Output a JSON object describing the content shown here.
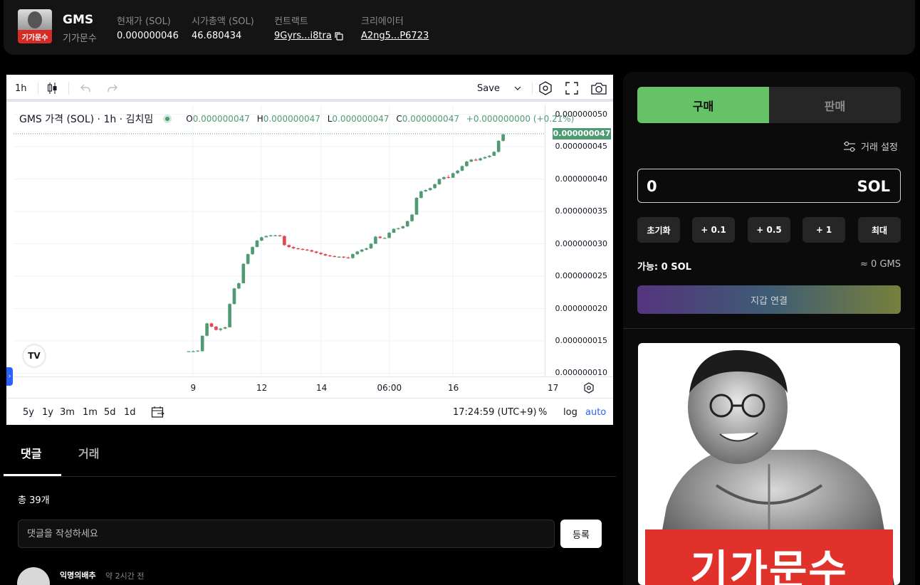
{
  "header": {
    "symbol": "GMS",
    "name": "기가문수",
    "logo_text": "기가문수",
    "price_label": "현재가 (SOL)",
    "price_value": "0.000000046",
    "mcap_label": "시가총액 (SOL)",
    "mcap_value": "46.680434",
    "contract_label": "컨트랙트",
    "contract_value": "9Gyrs...i8tra",
    "creator_label": "크리에이터",
    "creator_value": "A2ng5...P6723"
  },
  "chart_toolbar": {
    "interval": "1h",
    "save_label": "Save"
  },
  "chart_legend": {
    "title": "GMS 가격 (SOL) · 1h · 김치밈",
    "o_label": "O",
    "o_value": "0.000000047",
    "h_label": "H",
    "h_value": "0.000000047",
    "l_label": "L",
    "l_value": "0.000000047",
    "c_label": "C",
    "c_value": "0.000000047",
    "change": "+0.000000000 (+0.21%)"
  },
  "chart_bottom": {
    "ranges": [
      "5y",
      "1y",
      "3m",
      "1m",
      "5d",
      "1d"
    ],
    "clock": "17:24:59 (UTC+9)",
    "percent": "%",
    "log": "log",
    "auto": "auto"
  },
  "chart_data": {
    "type": "candlestick",
    "y_ticks": [
      "0.000000050",
      "0.000000045",
      "0.000000040",
      "0.000000035",
      "0.000000030",
      "0.000000025",
      "0.000000020",
      "0.000000015",
      "0.000000010"
    ],
    "x_ticks": [
      "9",
      "12",
      "14",
      "06:00",
      "16",
      "17"
    ],
    "last_price_label": "0.000000047",
    "ylim": [
      9.5e-09,
      5.15e-08
    ],
    "grid": true,
    "up_color": "#4f9a73",
    "down_color": "#e0474f",
    "candles": [
      [
        1.33e-08,
        1.34e-08,
        1.33e-08,
        1.34e-08
      ],
      [
        1.34e-08,
        1.35e-08,
        1.33e-08,
        1.34e-08
      ],
      [
        1.34e-08,
        1.35e-08,
        1.33e-08,
        1.35e-08
      ],
      [
        1.34e-08,
        1.58e-08,
        1.34e-08,
        1.58e-08
      ],
      [
        1.58e-08,
        1.78e-08,
        1.57e-08,
        1.77e-08
      ],
      [
        1.77e-08,
        1.78e-08,
        1.71e-08,
        1.72e-08
      ],
      [
        1.72e-08,
        1.73e-08,
        1.66e-08,
        1.67e-08
      ],
      [
        1.67e-08,
        1.7e-08,
        1.65e-08,
        1.69e-08
      ],
      [
        1.69e-08,
        1.72e-08,
        1.68e-08,
        1.71e-08
      ],
      [
        1.71e-08,
        2.08e-08,
        1.71e-08,
        2.07e-08
      ],
      [
        2.07e-08,
        2.32e-08,
        2.06e-08,
        2.31e-08
      ],
      [
        2.31e-08,
        2.4e-08,
        2.3e-08,
        2.39e-08
      ],
      [
        2.39e-08,
        2.7e-08,
        2.39e-08,
        2.69e-08
      ],
      [
        2.69e-08,
        2.85e-08,
        2.68e-08,
        2.84e-08
      ],
      [
        2.84e-08,
        2.96e-08,
        2.83e-08,
        2.95e-08
      ],
      [
        2.95e-08,
        3.06e-08,
        2.95e-08,
        3.05e-08
      ],
      [
        3.05e-08,
        3.11e-08,
        3.04e-08,
        3.1e-08
      ],
      [
        3.1e-08,
        3.13e-08,
        3.1e-08,
        3.12e-08
      ],
      [
        3.12e-08,
        3.14e-08,
        3.11e-08,
        3.13e-08
      ],
      [
        3.13e-08,
        3.14e-08,
        3.12e-08,
        3.13e-08
      ],
      [
        3.13e-08,
        3.14e-08,
        3.11e-08,
        3.12e-08
      ],
      [
        3.12e-08,
        3.13e-08,
        2.97e-08,
        2.98e-08
      ],
      [
        2.98e-08,
        2.99e-08,
        2.94e-08,
        2.95e-08
      ],
      [
        2.95e-08,
        2.96e-08,
        2.92e-08,
        2.93e-08
      ],
      [
        2.93e-08,
        2.94e-08,
        2.91e-08,
        2.92e-08
      ],
      [
        2.92e-08,
        2.93e-08,
        2.9e-08,
        2.91e-08
      ],
      [
        2.91e-08,
        2.92e-08,
        2.89e-08,
        2.9e-08
      ],
      [
        2.9e-08,
        2.91e-08,
        2.87e-08,
        2.88e-08
      ],
      [
        2.88e-08,
        2.89e-08,
        2.85e-08,
        2.86e-08
      ],
      [
        2.86e-08,
        2.87e-08,
        2.83e-08,
        2.84e-08
      ],
      [
        2.84e-08,
        2.85e-08,
        2.81e-08,
        2.82e-08
      ],
      [
        2.82e-08,
        2.83e-08,
        2.8e-08,
        2.81e-08
      ],
      [
        2.81e-08,
        2.82e-08,
        2.79e-08,
        2.8e-08
      ],
      [
        2.8e-08,
        2.81e-08,
        2.79e-08,
        2.8e-08
      ],
      [
        2.8e-08,
        2.81e-08,
        2.78e-08,
        2.79e-08
      ],
      [
        2.79e-08,
        2.8e-08,
        2.77e-08,
        2.78e-08
      ],
      [
        2.78e-08,
        2.85e-08,
        2.77e-08,
        2.84e-08
      ],
      [
        2.84e-08,
        2.89e-08,
        2.83e-08,
        2.88e-08
      ],
      [
        2.88e-08,
        2.92e-08,
        2.87e-08,
        2.91e-08
      ],
      [
        2.91e-08,
        2.94e-08,
        2.9e-08,
        2.93e-08
      ],
      [
        2.93e-08,
        3.01e-08,
        2.92e-08,
        3e-08
      ],
      [
        3e-08,
        3.12e-08,
        3e-08,
        3.11e-08
      ],
      [
        3.11e-08,
        3.12e-08,
        3.08e-08,
        3.09e-08
      ],
      [
        3.09e-08,
        3.1e-08,
        3.08e-08,
        3.09e-08
      ],
      [
        3.09e-08,
        3.18e-08,
        3.09e-08,
        3.17e-08
      ],
      [
        3.17e-08,
        3.24e-08,
        3.17e-08,
        3.23e-08
      ],
      [
        3.23e-08,
        3.25e-08,
        3.22e-08,
        3.24e-08
      ],
      [
        3.24e-08,
        3.28e-08,
        3.23e-08,
        3.27e-08
      ],
      [
        3.27e-08,
        3.36e-08,
        3.26e-08,
        3.35e-08
      ],
      [
        3.35e-08,
        3.46e-08,
        3.34e-08,
        3.45e-08
      ],
      [
        3.45e-08,
        3.72e-08,
        3.45e-08,
        3.71e-08
      ],
      [
        3.71e-08,
        3.82e-08,
        3.7e-08,
        3.81e-08
      ],
      [
        3.81e-08,
        3.84e-08,
        3.8e-08,
        3.83e-08
      ],
      [
        3.83e-08,
        3.87e-08,
        3.82e-08,
        3.86e-08
      ],
      [
        3.86e-08,
        3.93e-08,
        3.85e-08,
        3.92e-08
      ],
      [
        3.92e-08,
        4.01e-08,
        3.91e-08,
        4e-08
      ],
      [
        4e-08,
        4.04e-08,
        3.99e-08,
        4.03e-08
      ],
      [
        4.03e-08,
        4.06e-08,
        4.01e-08,
        4.02e-08
      ],
      [
        4.02e-08,
        4.1e-08,
        4.02e-08,
        4.09e-08
      ],
      [
        4.09e-08,
        4.14e-08,
        4.08e-08,
        4.13e-08
      ],
      [
        4.13e-08,
        4.21e-08,
        4.12e-08,
        4.2e-08
      ],
      [
        4.2e-08,
        4.28e-08,
        4.19e-08,
        4.27e-08
      ],
      [
        4.27e-08,
        4.31e-08,
        4.26e-08,
        4.3e-08
      ],
      [
        4.3e-08,
        4.32e-08,
        4.28e-08,
        4.29e-08
      ],
      [
        4.29e-08,
        4.33e-08,
        4.28e-08,
        4.32e-08
      ],
      [
        4.32e-08,
        4.35e-08,
        4.31e-08,
        4.34e-08
      ],
      [
        4.34e-08,
        4.37e-08,
        4.33e-08,
        4.36e-08
      ],
      [
        4.36e-08,
        4.43e-08,
        4.36e-08,
        4.42e-08
      ],
      [
        4.42e-08,
        4.6e-08,
        4.41e-08,
        4.59e-08
      ],
      [
        4.59e-08,
        4.7e-08,
        4.58e-08,
        4.69e-08
      ]
    ]
  },
  "tabs": {
    "comments": "댓글",
    "trades": "거래"
  },
  "comments": {
    "count": "총 39개",
    "placeholder": "댓글을 작성하세요",
    "submit": "등록",
    "first_user": "익명의배추",
    "first_time": "약 2시간 전"
  },
  "trade": {
    "buy": "구매",
    "sell": "판매",
    "settings": "거래 설정",
    "amount": "0",
    "unit": "SOL",
    "quick": [
      "초기화",
      "+ 0.1",
      "+ 0.5",
      "+ 1",
      "최대"
    ],
    "available": "가능: 0 SOL",
    "approx": "≈ 0 GMS",
    "connect": "지갑 연결"
  },
  "token_image": {
    "caption": "기가문수"
  }
}
